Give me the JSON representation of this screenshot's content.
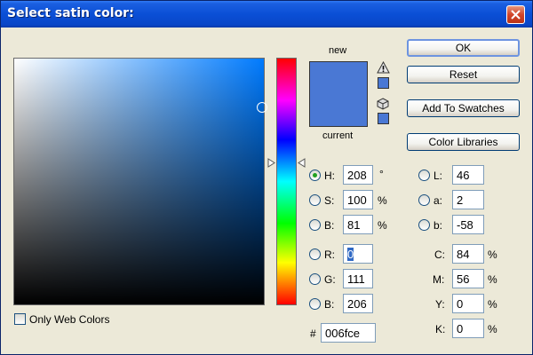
{
  "window": {
    "title": "Select satin color:"
  },
  "preview": {
    "new_label": "new",
    "current_label": "current",
    "new_color": "#4a78d4",
    "current_color": "#4a78d4"
  },
  "buttons": {
    "ok": "OK",
    "reset": "Reset",
    "add_to_swatches": "Add To Swatches",
    "color_libraries": "Color Libraries"
  },
  "hsb": {
    "h": {
      "label": "H:",
      "value": "208",
      "unit": "°",
      "selected": true
    },
    "s": {
      "label": "S:",
      "value": "100",
      "unit": "%"
    },
    "b": {
      "label": "B:",
      "value": "81",
      "unit": "%"
    }
  },
  "rgb": {
    "r": {
      "label": "R:",
      "value": "0"
    },
    "g": {
      "label": "G:",
      "value": "111"
    },
    "b": {
      "label": "B:",
      "value": "206"
    }
  },
  "hex": {
    "label": "#",
    "value": "006fce"
  },
  "lab": {
    "l": {
      "label": "L:",
      "value": "46"
    },
    "a": {
      "label": "a:",
      "value": "2"
    },
    "b": {
      "label": "b:",
      "value": "-58"
    }
  },
  "cmyk": {
    "c": {
      "label": "C:",
      "value": "84",
      "unit": "%"
    },
    "m": {
      "label": "M:",
      "value": "56",
      "unit": "%"
    },
    "y": {
      "label": "Y:",
      "value": "0",
      "unit": "%"
    },
    "k": {
      "label": "K:",
      "value": "0",
      "unit": "%"
    }
  },
  "options": {
    "only_web_colors": "Only Web Colors"
  },
  "icons": {
    "gamut_warning": "warning-triangle-icon",
    "web_safe": "cube-icon",
    "close": "close-icon"
  },
  "colors": {
    "title_bar": "#0a4fd6",
    "close": "#d2452a",
    "selected_radio": "#21a121",
    "highlight": "#316ac5"
  }
}
